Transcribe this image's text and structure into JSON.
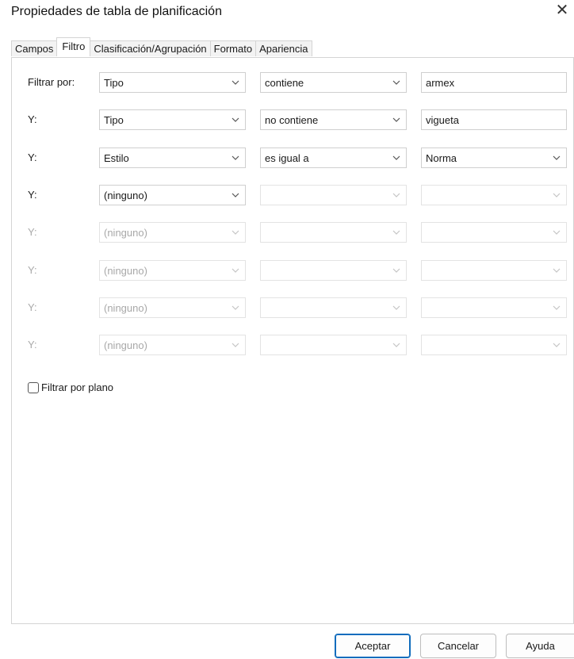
{
  "dialog": {
    "title": "Propiedades de tabla de planificación",
    "close_glyph": "✕"
  },
  "tabs": [
    {
      "label": "Campos",
      "active": false
    },
    {
      "label": "Filtro",
      "active": true
    },
    {
      "label": "Clasificación/Agrupación",
      "active": false
    },
    {
      "label": "Formato",
      "active": false
    },
    {
      "label": "Apariencia",
      "active": false
    }
  ],
  "filters": [
    {
      "label": "Filtrar por:",
      "field": "Tipo",
      "operator": "contiene",
      "value": "armex",
      "value_type": "text",
      "enabled": true
    },
    {
      "label": "Y:",
      "field": "Tipo",
      "operator": "no contiene",
      "value": "vigueta",
      "value_type": "text",
      "enabled": true
    },
    {
      "label": "Y:",
      "field": "Estilo",
      "operator": "es igual a",
      "value": "Norma",
      "value_type": "select",
      "enabled": true
    },
    {
      "label": "Y:",
      "field": "(ninguno)",
      "operator": "",
      "value": "",
      "value_type": "select",
      "enabled": true
    },
    {
      "label": "Y:",
      "field": "(ninguno)",
      "operator": "",
      "value": "",
      "value_type": "select",
      "enabled": false
    },
    {
      "label": "Y:",
      "field": "(ninguno)",
      "operator": "",
      "value": "",
      "value_type": "select",
      "enabled": false
    },
    {
      "label": "Y:",
      "field": "(ninguno)",
      "operator": "",
      "value": "",
      "value_type": "select",
      "enabled": false
    },
    {
      "label": "Y:",
      "field": "(ninguno)",
      "operator": "",
      "value": "",
      "value_type": "select",
      "enabled": false
    }
  ],
  "filter_by_sheet": {
    "label": "Filtrar por plano",
    "checked": false
  },
  "buttons": {
    "ok": "Aceptar",
    "cancel": "Cancelar",
    "help": "Ayuda"
  },
  "colors": {
    "accent": "#0f6cbd",
    "disabled_text": "#a8a8a8",
    "border": "#cfcfcf"
  }
}
